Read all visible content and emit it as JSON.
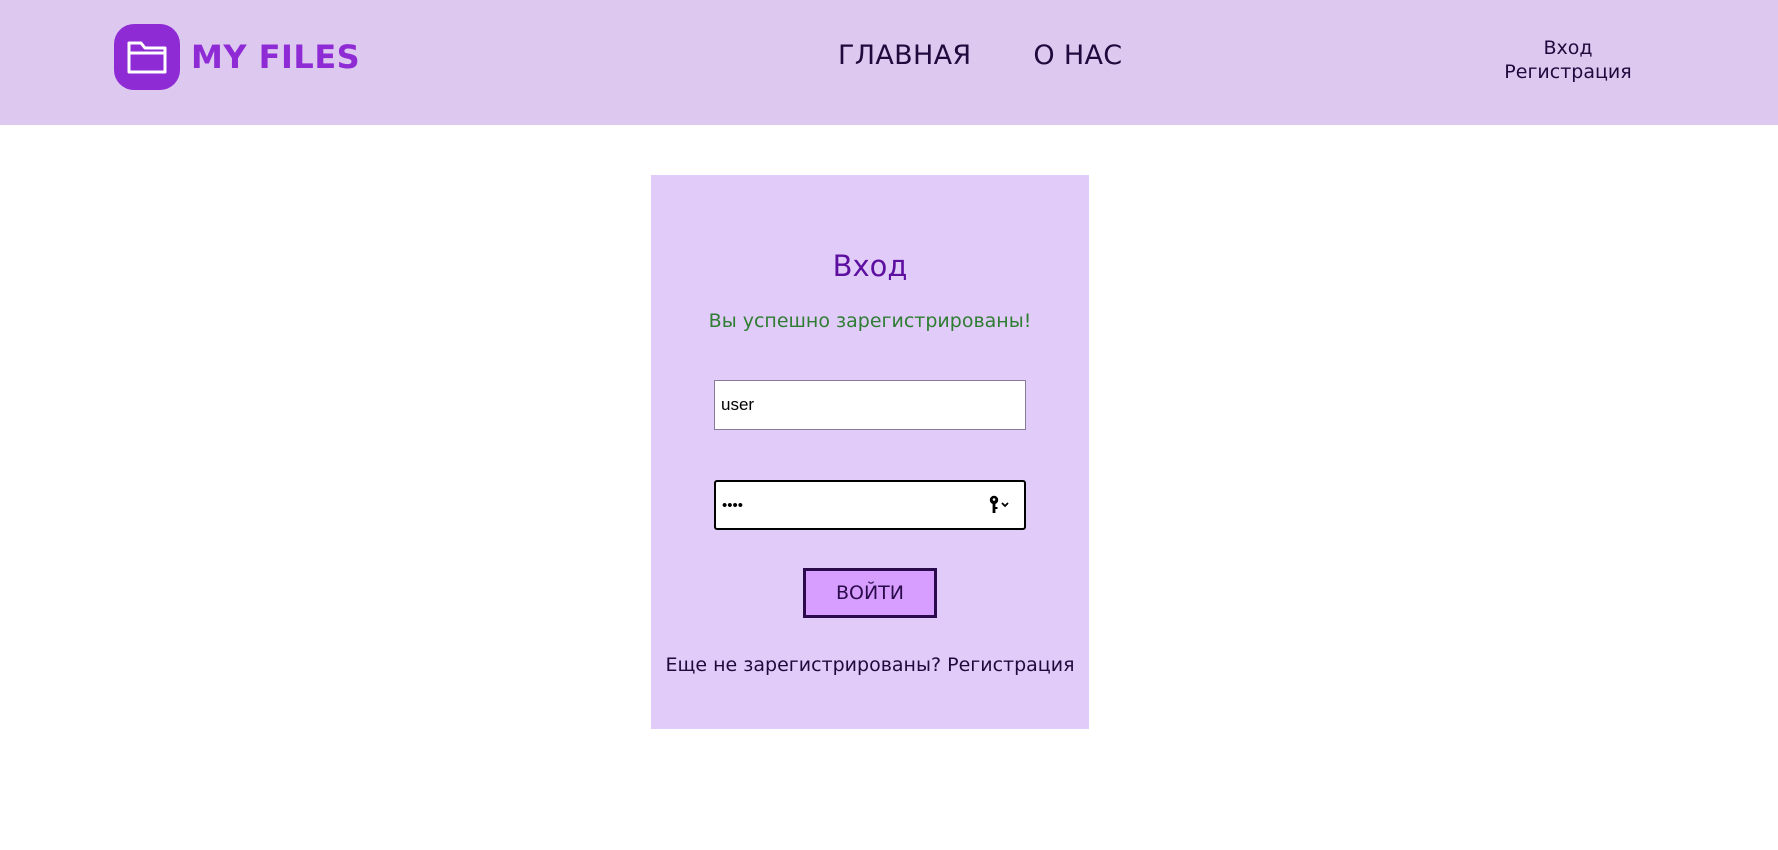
{
  "header": {
    "logo_text": "MY FILES",
    "nav": {
      "home": "ГЛАВНАЯ",
      "about": "О НАС"
    },
    "auth": {
      "login": "Вход",
      "register": "Регистрация"
    }
  },
  "login_form": {
    "title": "Вход",
    "success_message": "Вы успешно зарегистрированы!",
    "username_value": "user",
    "password_masked": "••••",
    "submit_label": "ВОЙТИ",
    "register_prompt": "Еще не зарегистрированы?",
    "register_link": "Регистрация"
  },
  "colors": {
    "header_bg": "#ddc8f0",
    "brand": "#8e2bd4",
    "card_bg": "#e1cbf8",
    "title": "#5d0fa0",
    "success": "#2e7d32",
    "button_bg": "#d79eff"
  },
  "icons": {
    "logo": "folder-icon",
    "password_manager": "key-icon"
  }
}
